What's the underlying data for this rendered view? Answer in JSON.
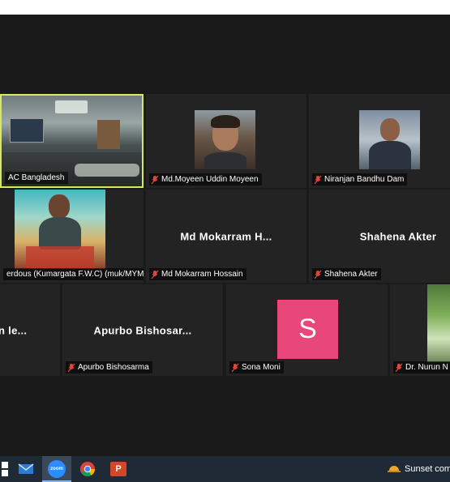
{
  "tiles": {
    "brac": {
      "label": "AC Bangladesh"
    },
    "moyeen": {
      "label": "Md.Moyeen Uddin Moyeen"
    },
    "niranjan": {
      "label": "Niranjan Bandhu Dam"
    },
    "ferdous": {
      "label": "erdous (Kumargata F.W.C) (muk/MYM)"
    },
    "mokarram": {
      "display": "Md Mokarram H...",
      "label": "Md Mokarram Hossain"
    },
    "shahena": {
      "display": "Shahena Akter",
      "label": "Shahena Akter"
    },
    "partial_left": {
      "display": "n le..."
    },
    "apurbo": {
      "display": "Apurbo Bishosar...",
      "label": "Apurbo Bishosarma"
    },
    "sona": {
      "avatar_letter": "S",
      "label": "Sona Moni"
    },
    "nurun": {
      "label": "Dr. Nurun N"
    }
  },
  "taskbar": {
    "icons": [
      "windows-start-icon",
      "mail-icon",
      "zoom-icon",
      "chrome-icon",
      "powerpoint-icon"
    ],
    "zoom_text": "zoom",
    "ppt_text": "P",
    "weather_text": "Sunset com"
  },
  "colors": {
    "meeting_bg": "#1a1a1a",
    "tile_bg": "#232323",
    "active_speaker_border": "#d6e85c",
    "muted_mic": "#e0443a",
    "avatar_bg": "#e8477a",
    "taskbar_bg": "#1f2a36"
  }
}
